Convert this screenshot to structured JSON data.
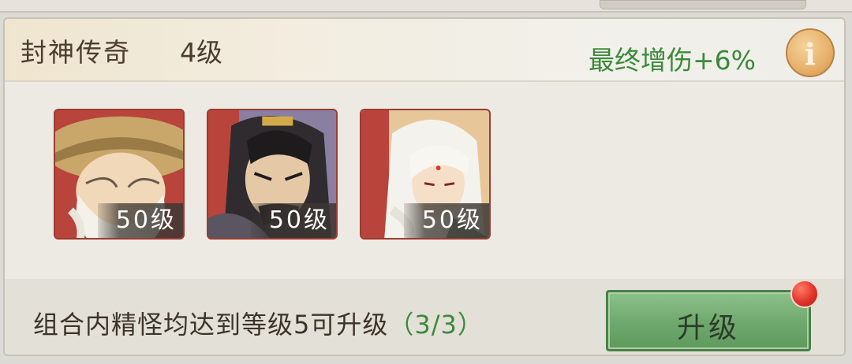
{
  "combo": {
    "title": "封神传奇",
    "level": "4级",
    "bonus": "最终增伤+6%",
    "info_icon": "info-icon"
  },
  "heroes": [
    {
      "level_label": "50级",
      "portrait": "old-sage-with-straw-hat"
    },
    {
      "level_label": "50级",
      "portrait": "dark-haired-general"
    },
    {
      "level_label": "50级",
      "portrait": "white-haired-immortal"
    }
  ],
  "footer": {
    "requirement": "组合内精怪均达到等级5可升级",
    "progress": "（3/3）",
    "upgrade_label": "升级"
  },
  "colors": {
    "bonus_green": "#3b8a3a",
    "button_green": "#6ea86c",
    "portrait_red": "#b8443c",
    "notification_red": "#e0342a"
  }
}
